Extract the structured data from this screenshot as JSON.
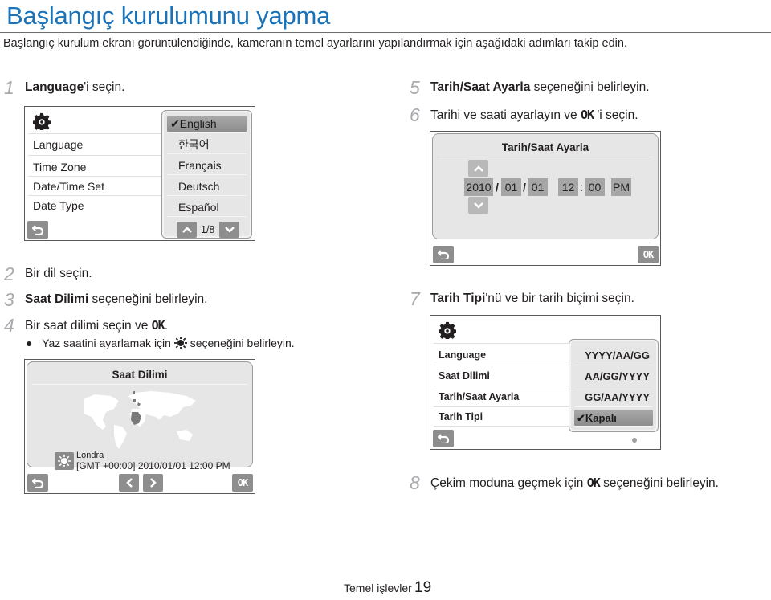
{
  "page": {
    "title": "Başlangıç kurulumunu yapma",
    "intro": "Başlangıç kurulum ekranı görüntülendiğinde, kameranın temel ayarlarını yapılandırmak için aşağıdaki adımları takip edin.",
    "footer_section": "Temel işlevler",
    "page_number": "19"
  },
  "steps": [
    {
      "num": "1",
      "bold": "Language",
      "text": "'i seçin."
    },
    {
      "num": "2",
      "text": "Bir dil seçin."
    },
    {
      "num": "3",
      "bold": "Saat Dilimi",
      "text": " seçeneğini belirleyin."
    },
    {
      "num": "4",
      "text_before": "Bir saat dilimi seçin ve ",
      "ok": "OK",
      "text_after": "."
    },
    {
      "num": "5",
      "bold": "Tarih/Saat Ayarla",
      "text": " seçeneğini belirleyin."
    },
    {
      "num": "6",
      "text_before": "Tarihi ve saati ayarlayın ve ",
      "ok": "OK",
      "text_after": " 'i seçin."
    },
    {
      "num": "7",
      "bold": "Tarih Tipi",
      "text": "'nü ve bir tarih biçimi seçin."
    },
    {
      "num": "8",
      "text_before": "Çekim moduna geçmek için ",
      "ok": "OK",
      "text_after": " seçeneğini belirleyin."
    }
  ],
  "step4_bullet": {
    "text_before": "Yaz saatini ayarlamak için ",
    "icon": "daylight-saving-sun-icon",
    "text_after": " seçeneğini belirleyin."
  },
  "screen_language": {
    "menu": [
      "Language",
      "Time Zone",
      "Date/Time Set",
      "Date Type"
    ],
    "options": [
      "English",
      "한국어",
      "Français",
      "Deutsch",
      "Español"
    ],
    "selected": "English",
    "page_indicator": "1/8"
  },
  "screen_timezone": {
    "title": "Saat Dilimi",
    "city": "Londra",
    "info": "[GMT +00:00] 2010/01/01 12:00 PM",
    "ok": "OK"
  },
  "screen_datetime": {
    "title": "Tarih/Saat Ayarla",
    "year": "2010",
    "month": "01",
    "day": "01",
    "hour": "12",
    "minute": "00",
    "ampm": "PM",
    "date_sep": "/",
    "time_sep": ":",
    "ok": "OK"
  },
  "screen_datetype": {
    "menu": [
      "Language",
      "Saat Dilimi",
      "Tarih/Saat Ayarla",
      "Tarih Tipi"
    ],
    "options": [
      "YYYY/AA/GG",
      "AA/GG/YYYY",
      "GG/AA/YYYY",
      "Kapalı"
    ],
    "selected": "Kapalı"
  },
  "colors": {
    "title": "#1a73b8",
    "step_number": "#a7a9ac",
    "button": "#8e8e8e",
    "panel": "#e6e6e6"
  }
}
